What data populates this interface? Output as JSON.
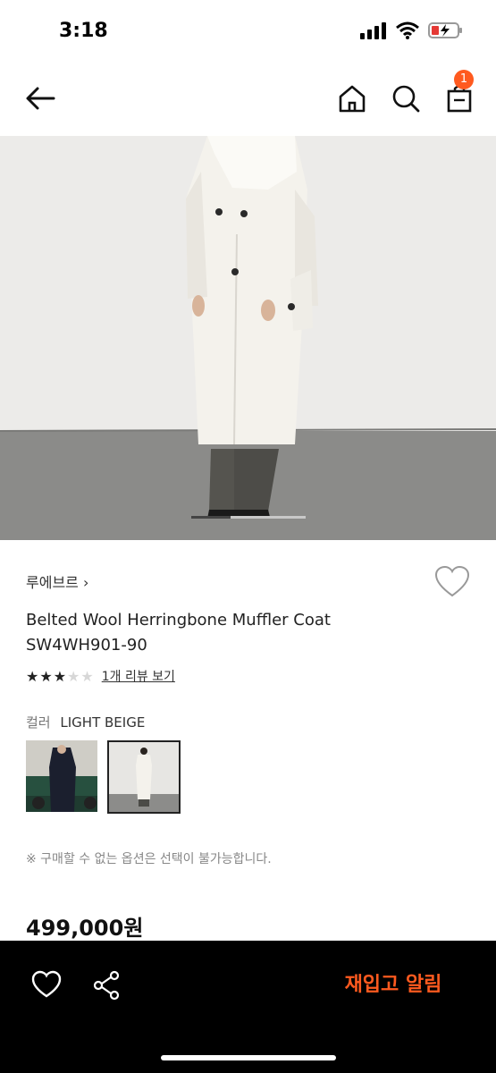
{
  "status_bar": {
    "time": "3:18"
  },
  "nav": {
    "cart_count": "1"
  },
  "product": {
    "brand": "루에브르 ›",
    "name_line1": "Belted Wool Herringbone Muffler Coat",
    "name_line2": "SW4WH901-90",
    "rating": {
      "value": 3,
      "max": 5,
      "review_link": "1개 리뷰 보기"
    },
    "color_label": "컬러",
    "color_value": "LIGHT BEIGE",
    "notice": "※ 구매할 수 없는 옵션은 선택이 불가능합니다.",
    "price": "499,000원"
  },
  "carousel": {
    "position": 0.33
  },
  "bottom_bar": {
    "restock_label": "재입고 알림"
  },
  "colors": {
    "accent": "#ff5a1f",
    "bottom_bar": "#000000"
  }
}
